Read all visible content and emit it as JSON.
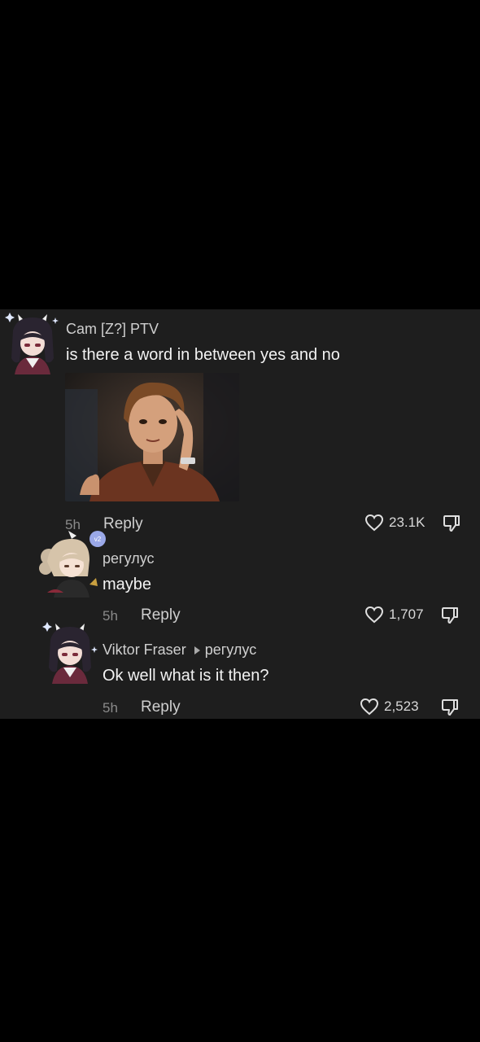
{
  "comments": [
    {
      "username": "Cam [Z?] PTV",
      "text": "is there a word in between yes and no",
      "time": "5h",
      "reply": "Reply",
      "likes": "23.1K"
    },
    {
      "username": "регулус",
      "text": "maybe",
      "time": "5h",
      "reply": "Reply",
      "likes": "1,707"
    },
    {
      "username": "Viktor Fraser",
      "reply_to": "регулус",
      "text": "Ok well what is it then?",
      "time": "5h",
      "reply": "Reply",
      "likes": "2,523"
    }
  ],
  "icons": {
    "like": "heart-icon",
    "dislike": "thumbs-down-icon"
  },
  "colors": {
    "background": "#000000",
    "panel": "#1e1e1e",
    "text": "#f2f2f2",
    "muted": "#8a8a8a"
  }
}
